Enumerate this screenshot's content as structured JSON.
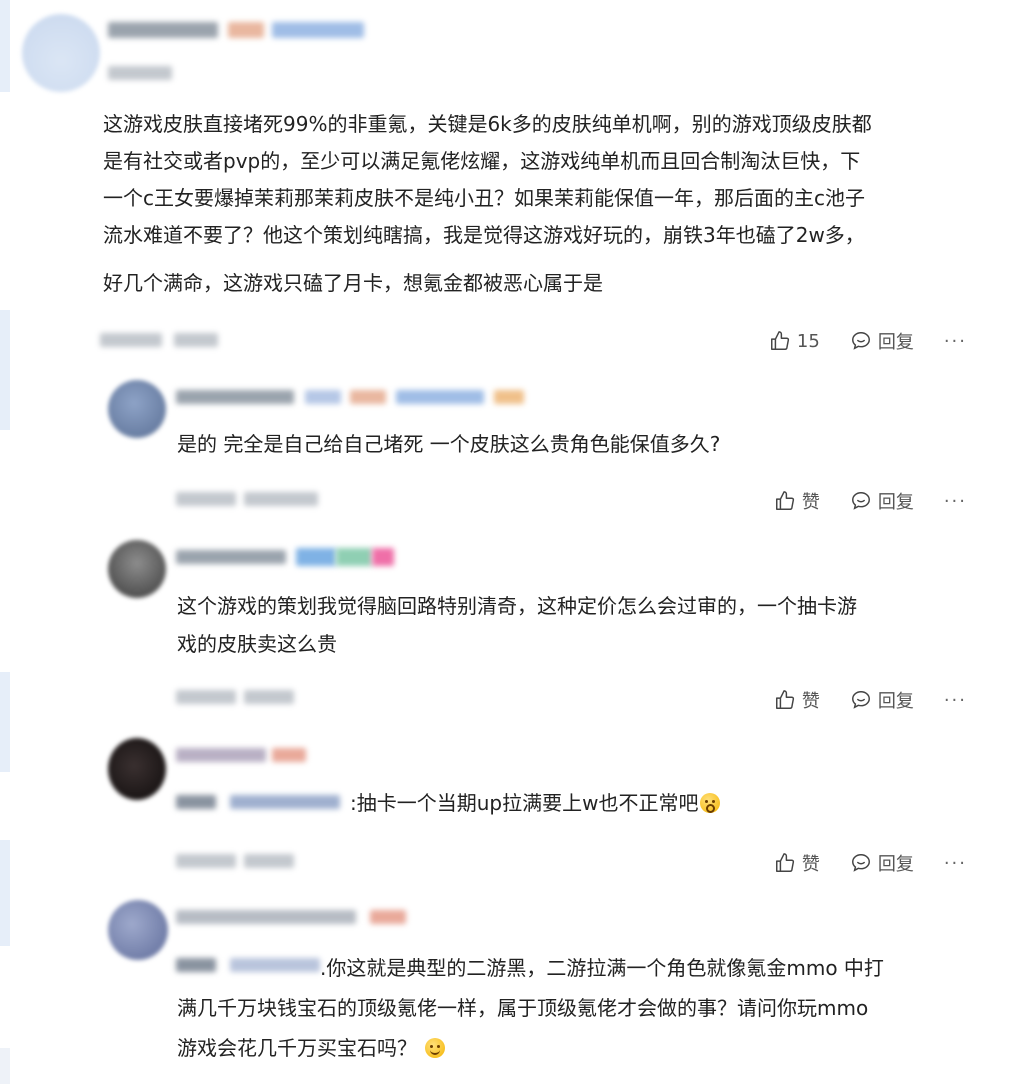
{
  "main_comment": {
    "lines": [
      "这游戏皮肤直接堵死99%的非重氪，关键是6k多的皮肤纯单机啊，别的游戏顶级皮肤都",
      "是有社交或者pvp的，至少可以满足氪佬炫耀，这游戏纯单机而且回合制淘汰巨快，下",
      "一个c王女要爆掉茉莉那茉莉皮肤不是纯小丑？如果茉莉能保值一年，那后面的主c池子",
      "流水难道不要了？他这个策划纯瞎搞，我是觉得这游戏好玩的，崩铁3年也磕了2w多，",
      "好几个满命，这游戏只磕了月卡，想氪金都被恶心属于是"
    ],
    "like_count": "15",
    "reply_label": "回复",
    "more_label": "···"
  },
  "replies": [
    {
      "lines": [
        "是的 完全是自己给自己堵死 一个皮肤这么贵角色能保值多久?"
      ],
      "like_label": "赞",
      "reply_label": "回复",
      "more_label": "···"
    },
    {
      "lines": [
        "这个游戏的策划我觉得脑回路特别清奇，这种定价怎么会过审的，一个抽卡游",
        "戏的皮肤卖这么贵"
      ],
      "like_label": "赞",
      "reply_label": "回复",
      "more_label": "···"
    },
    {
      "lines": [
        ":抽卡一个当期up拉满要上w也不正常吧"
      ],
      "emoji": "astonished-emoji",
      "like_label": "赞",
      "reply_label": "回复",
      "more_label": "···"
    },
    {
      "lines": [
        ".你这就是典型的二游黑，二游拉满一个角色就像氪金mmo 中打",
        "满几千万块钱宝石的顶级氪佬一样，属于顶级氪佬才会做的事？请问你玩mmo",
        "游戏会花几千万买宝石吗？"
      ],
      "emoji": "smile-emoji"
    }
  ],
  "colors": {
    "text": "#222222",
    "meta": "#555555",
    "edge": "#e6eef9"
  }
}
